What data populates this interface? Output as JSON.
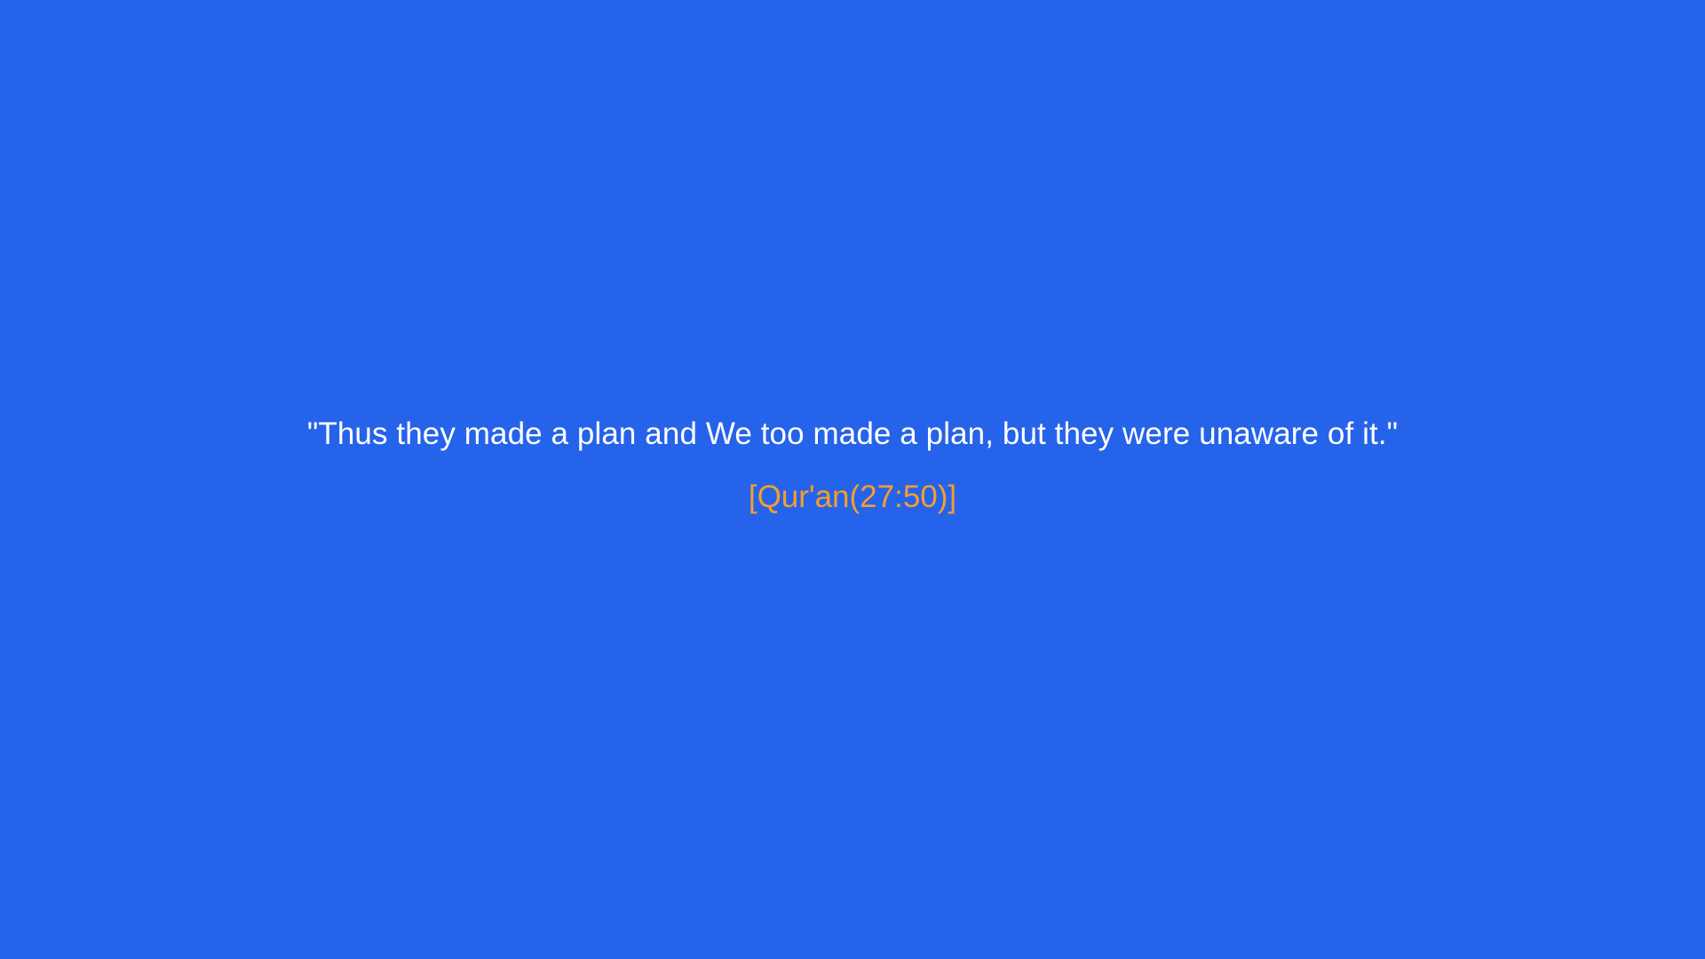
{
  "theme": {
    "background": "#2563EB",
    "quote_color": "#FFFFFF",
    "source_color": "#F59E2B"
  },
  "quote": {
    "text": "\"Thus they made a plan and We too made a plan, but they were unaware of it.\"",
    "source": "[Qur'an(27:50)]"
  }
}
